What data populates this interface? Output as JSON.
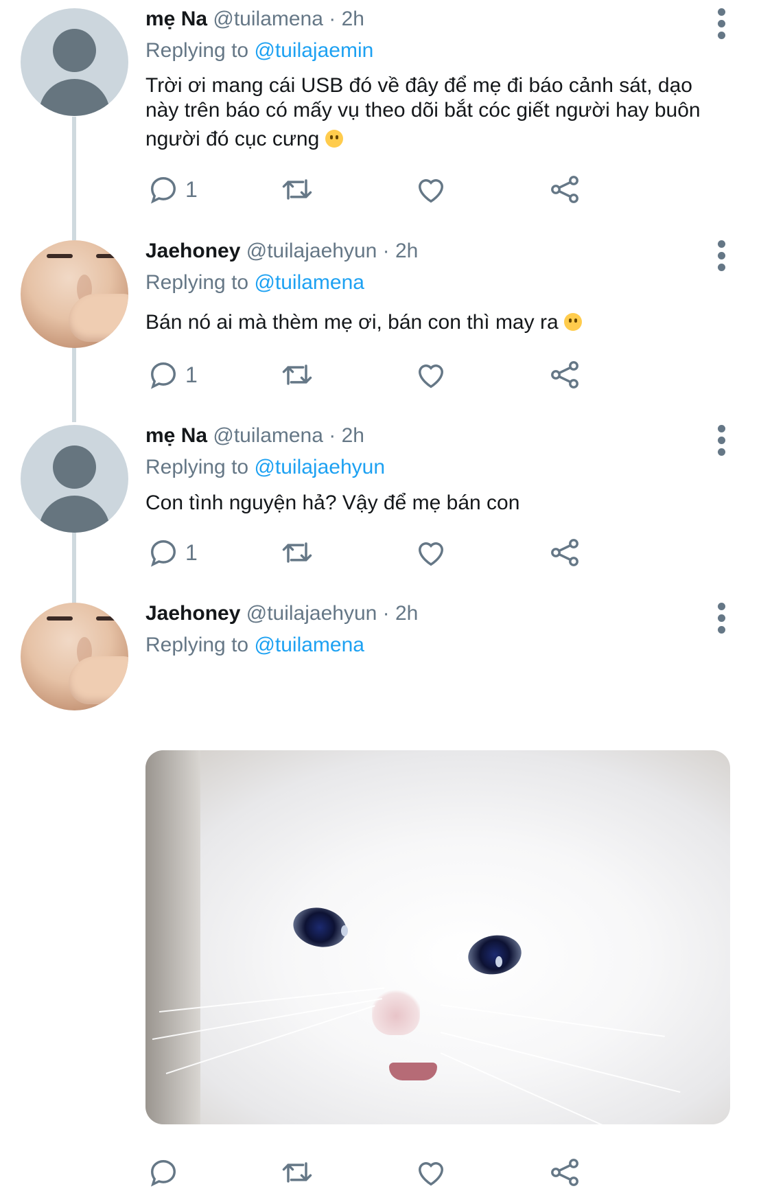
{
  "tweets": [
    {
      "name": "mẹ Na",
      "handle": "@tuilamena",
      "time": "· 2h",
      "replying_prefix": "Replying to ",
      "replying_handle": "@tuilajaemin",
      "text_line1": "Trời ơi mang cái USB đó về đây để mẹ đi báo cảnh sát, dạo",
      "text_line2": "này trên báo có mấy vụ theo dõi bắt cóc giết người hay buôn",
      "text_line3": "người đó cục cưng",
      "reply_count": "1",
      "avatar": "default-avatar"
    },
    {
      "name": "Jaehoney",
      "handle": "@tuilajaehyun",
      "time": "· 2h",
      "replying_prefix": "Replying to ",
      "replying_handle": "@tuilamena",
      "text_line1": "Bán nó ai mà thèm mẹ ơi, bán con thì may ra",
      "reply_count": "1",
      "avatar": "photo-avatar"
    },
    {
      "name": "mẹ Na",
      "handle": "@tuilamena",
      "time": "· 2h",
      "replying_prefix": "Replying to ",
      "replying_handle": "@tuilajaehyun",
      "text_line1": "Con tình nguyện hả? Vậy để mẹ bán con",
      "reply_count": "1",
      "avatar": "default-avatar"
    },
    {
      "name": "Jaehoney",
      "handle": "@tuilajaehyun",
      "time": "· 2h",
      "replying_prefix": "Replying to ",
      "replying_handle": "@tuilamena",
      "reply_count": "",
      "avatar": "photo-avatar",
      "media": "crying-cat-image"
    }
  ],
  "icons": {
    "reply": "speech-bubble-icon",
    "retweet": "retweet-icon",
    "like": "heart-icon",
    "share": "share-icon",
    "more": "vertical-dots-icon"
  },
  "colors": {
    "text": "#14171a",
    "muted": "#657786",
    "link": "#1da1f2",
    "thread_line": "#cfd9de"
  }
}
